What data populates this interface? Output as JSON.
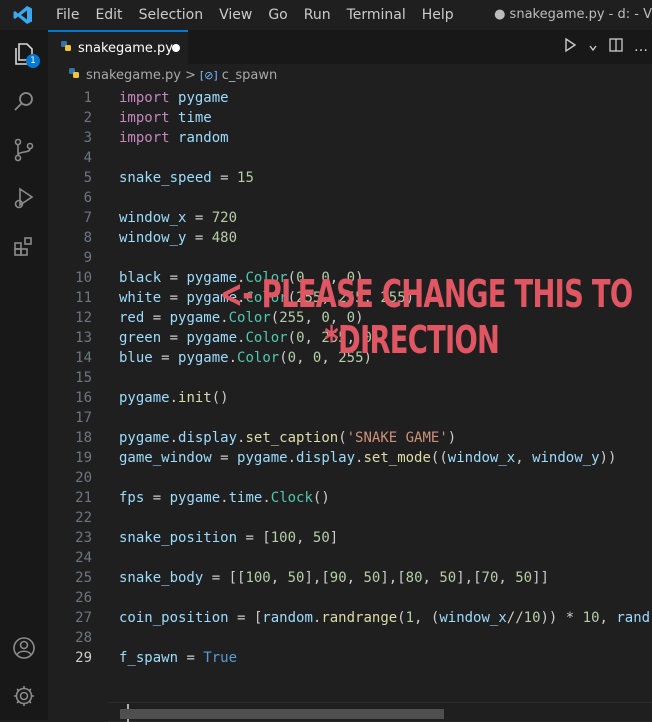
{
  "menu": [
    "File",
    "Edit",
    "Selection",
    "View",
    "Go",
    "Run",
    "Terminal",
    "Help"
  ],
  "window_title": "● snakegame.py - d: - V",
  "activity": {
    "badge": "1"
  },
  "tab": {
    "label": "snakegame.py"
  },
  "breadcrumb": {
    "file": "snakegame.py",
    "separator": ">",
    "symbol": "c_spawn"
  },
  "code_lines": [
    {
      "n": "1",
      "text": "import pygame"
    },
    {
      "n": "2",
      "text": "import time"
    },
    {
      "n": "3",
      "text": "import random"
    },
    {
      "n": "4",
      "text": ""
    },
    {
      "n": "5",
      "text": "snake_speed = 15"
    },
    {
      "n": "6",
      "text": ""
    },
    {
      "n": "7",
      "text": "window_x = 720"
    },
    {
      "n": "8",
      "text": "window_y = 480"
    },
    {
      "n": "9",
      "text": ""
    },
    {
      "n": "10",
      "text": "black = pygame.Color(0, 0, 0)"
    },
    {
      "n": "11",
      "text": "white = pygame.Color(255, 255, 255)"
    },
    {
      "n": "12",
      "text": "red = pygame.Color(255, 0, 0)"
    },
    {
      "n": "13",
      "text": "green = pygame.Color(0, 255, 0)"
    },
    {
      "n": "14",
      "text": "blue = pygame.Color(0, 0, 255)"
    },
    {
      "n": "15",
      "text": ""
    },
    {
      "n": "16",
      "text": "pygame.init()"
    },
    {
      "n": "17",
      "text": ""
    },
    {
      "n": "18",
      "text": "pygame.display.set_caption('SNAKE GAME')"
    },
    {
      "n": "19",
      "text": "game_window = pygame.display.set_mode((window_x, window_y))"
    },
    {
      "n": "20",
      "text": ""
    },
    {
      "n": "21",
      "text": "fps = pygame.time.Clock()"
    },
    {
      "n": "22",
      "text": ""
    },
    {
      "n": "23",
      "text": "snake_position = [100, 50]"
    },
    {
      "n": "24",
      "text": ""
    },
    {
      "n": "25",
      "text": "snake_body = [[100, 50],[90, 50],[80, 50],[70, 50]]"
    },
    {
      "n": "26",
      "text": ""
    },
    {
      "n": "27",
      "text": "coin_position = [random.randrange(1, (window_x//10)) * 10, rand"
    },
    {
      "n": "28",
      "text": ""
    },
    {
      "n": "29",
      "text": "f_spawn = True"
    }
  ],
  "annotation": {
    "line1": "<- PLEASE CHANGE THIS TO",
    "line2": "*DIRECTION"
  },
  "colors": {
    "accent": "#0078d4",
    "annotation": "#e05663",
    "keyword": "#c586c0",
    "number": "#b5cea8",
    "string": "#ce9178"
  }
}
